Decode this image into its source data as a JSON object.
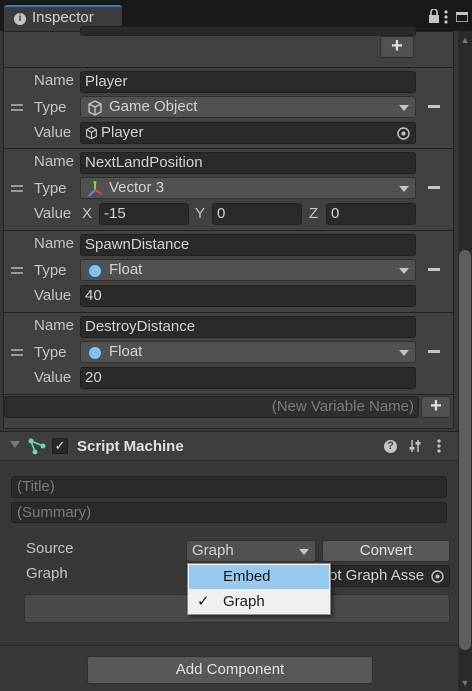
{
  "tab": {
    "label": "Inspector"
  },
  "variables": [
    {
      "name_label": "Name",
      "name": "Player",
      "type_label": "Type",
      "type": "Game Object",
      "value_label": "Value",
      "value": "Player"
    },
    {
      "name_label": "Name",
      "name": "NextLandPosition",
      "type_label": "Type",
      "type": "Vector 3",
      "value_label": "Value",
      "x_label": "X",
      "x": "-15",
      "y_label": "Y",
      "y": "0",
      "z_label": "Z",
      "z": "0"
    },
    {
      "name_label": "Name",
      "name": "SpawnDistance",
      "type_label": "Type",
      "type": "Float",
      "value_label": "Value",
      "value": "40"
    },
    {
      "name_label": "Name",
      "name": "DestroyDistance",
      "type_label": "Type",
      "type": "Float",
      "value_label": "Value",
      "value": "20"
    }
  ],
  "new_variable": {
    "placeholder": "(New Variable Name)"
  },
  "add_icon": "+",
  "script_machine": {
    "title": "Script Machine",
    "title_placeholder": "(Title)",
    "summary_placeholder": "(Summary)",
    "source_label": "Source",
    "source_value": "Graph",
    "convert_label": "Convert",
    "graph_label": "Graph",
    "graph_field_text": "ot Graph Asse"
  },
  "popup": {
    "items": [
      {
        "label": "Embed",
        "checked": false
      },
      {
        "label": "Graph",
        "checked": true
      }
    ]
  },
  "add_component_label": "Add Component",
  "icons": {
    "info": "i",
    "check": "✓"
  },
  "colors": {
    "accent": "#3a79bb",
    "highlight": "#99c9ef",
    "float_dot": "#7fc3f5"
  }
}
